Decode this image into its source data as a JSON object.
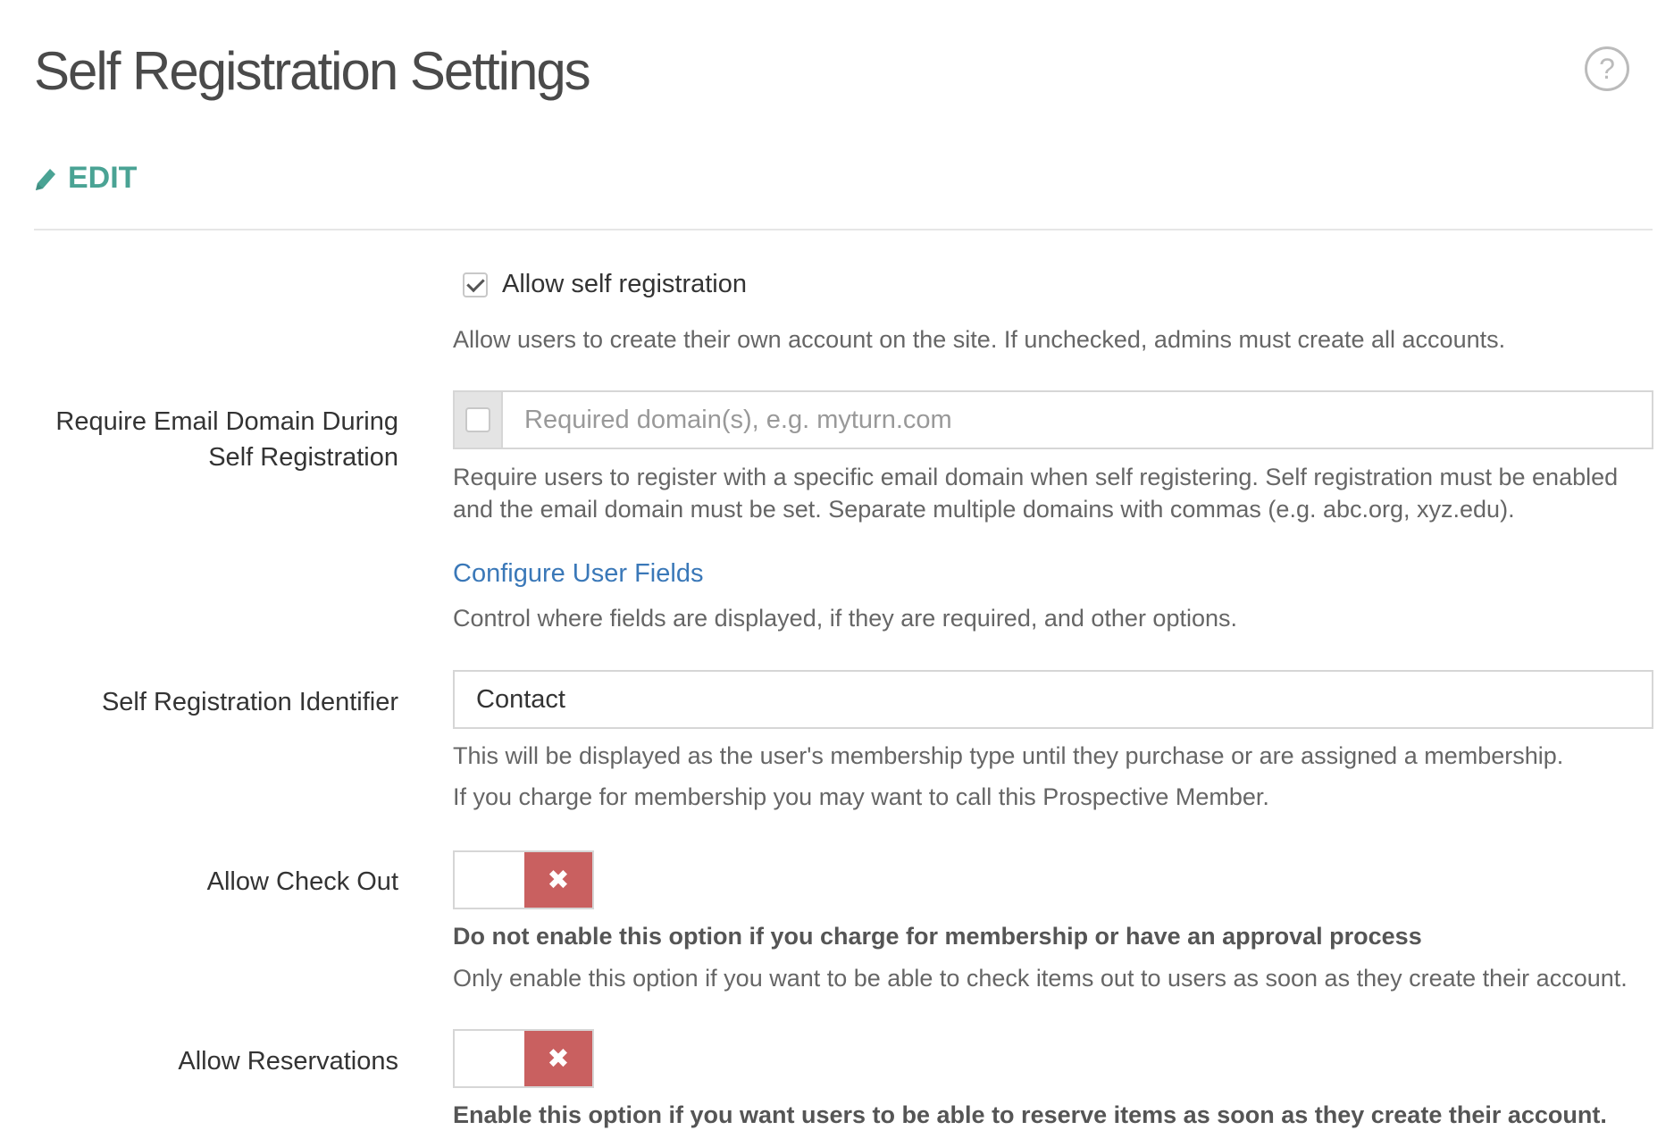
{
  "header": {
    "title": "Self Registration Settings",
    "help_glyph": "?",
    "edit_label": "EDIT"
  },
  "colors": {
    "accent": "#4aa394",
    "link": "#3a78b8",
    "toggle_off": "#c96060"
  },
  "allow_self_registration": {
    "label": "Allow self registration",
    "checked": true,
    "help": "Allow users to create their own account on the site. If unchecked, admins must create all accounts."
  },
  "email_domain": {
    "label_line1": "Require Email Domain During",
    "label_line2": "Self Registration",
    "checked": false,
    "placeholder": "Required domain(s), e.g. myturn.com",
    "value": "",
    "help_line1": "Require users to register with a specific email domain when self registering. Self registration must be enabled",
    "help_line2": "and the email domain must be set. Separate multiple domains with commas (e.g. abc.org, xyz.edu)."
  },
  "user_fields": {
    "link_label": "Configure User Fields",
    "help": "Control where fields are displayed, if they are required, and other options."
  },
  "identifier": {
    "label": "Self Registration Identifier",
    "value": "Contact",
    "help_line1": "This will be displayed as the user's membership type until they purchase or are assigned a membership.",
    "help_line2": "If you charge for membership you may want to call this Prospective Member."
  },
  "check_out": {
    "label": "Allow Check Out",
    "enabled": false,
    "toggle_glyph": "✖",
    "warning": "Do not enable this option if you charge for membership or have an approval process",
    "help": "Only enable this option if you want to be able to check items out to users as soon as they create their account."
  },
  "reservations": {
    "label": "Allow Reservations",
    "enabled": false,
    "toggle_glyph": "✖",
    "warning": "Enable this option if you want users to be able to reserve items as soon as they create their account."
  }
}
